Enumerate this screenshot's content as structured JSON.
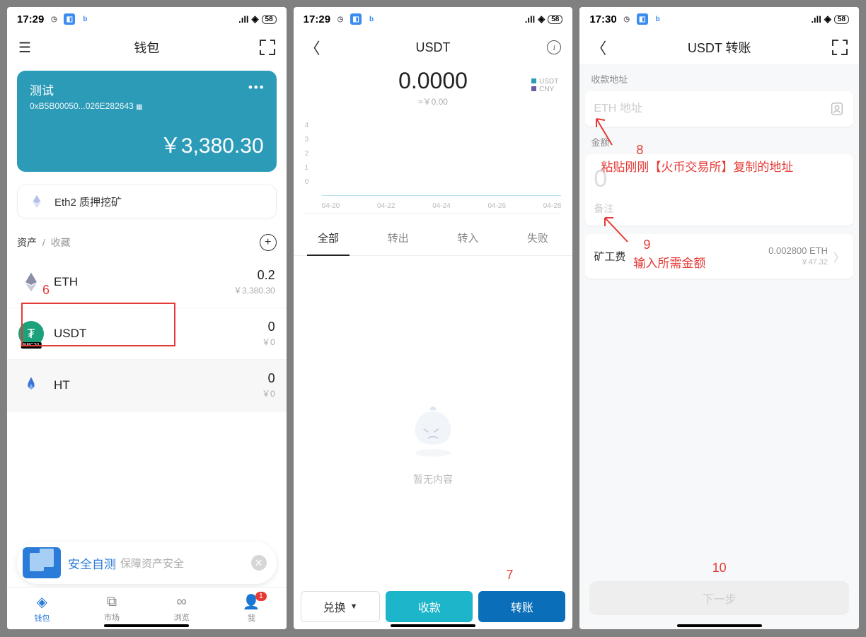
{
  "status": {
    "time1": "17:29",
    "time2": "17:29",
    "time3": "17:30",
    "net": "58"
  },
  "screen1": {
    "title": "钱包",
    "wallet_name": "测试",
    "wallet_addr": "0xB5B00050...026E282643",
    "wallet_balance": "￥3,380.30",
    "eth2_label": "Eth2 质押挖矿",
    "tab_assets": "资产",
    "tab_fav": "收藏",
    "assets": [
      {
        "sym": "ETH",
        "amt": "0.2",
        "val": "￥3,380.30"
      },
      {
        "sym": "USDT",
        "amt": "0",
        "val": "￥0",
        "tag": "ERC20"
      },
      {
        "sym": "HT",
        "amt": "0",
        "val": "￥0"
      }
    ],
    "promo_t1": "安全自测",
    "promo_t2": "保障资产安全",
    "tabs": {
      "wallet": "钱包",
      "market": "市场",
      "browse": "浏览",
      "me": "我",
      "badge": "1"
    },
    "annotation_6": "6"
  },
  "screen2": {
    "title": "USDT",
    "amount": "0.0000",
    "sub": "≈￥0.00",
    "legend": {
      "a": "USDT",
      "b": "CNY"
    },
    "yticks": [
      "4",
      "3",
      "2",
      "1",
      "0"
    ],
    "xticks": [
      "04-20",
      "04-22",
      "04-24",
      "04-26",
      "04-28"
    ],
    "txtabs": {
      "all": "全部",
      "out": "转出",
      "in": "转入",
      "fail": "失败"
    },
    "empty": "暂无内容",
    "btn_exchange": "兑换",
    "btn_receive": "收款",
    "btn_transfer": "转账",
    "annotation_7": "7"
  },
  "screen3": {
    "title": "USDT 转账",
    "label_addr": "收款地址",
    "placeholder_addr": "ETH 地址",
    "label_amt": "金额",
    "amt_placeholder": "0",
    "remark": "备注",
    "fee_label": "矿工费",
    "fee_amt": "0.002800 ETH",
    "fee_cny": "￥47.32",
    "next": "下一步",
    "annotation_8_num": "8",
    "annotation_8": "粘贴刚刚【火币交易所】复制的地址",
    "annotation_9_num": "9",
    "annotation_9": "输入所需金额",
    "annotation_10": "10"
  }
}
